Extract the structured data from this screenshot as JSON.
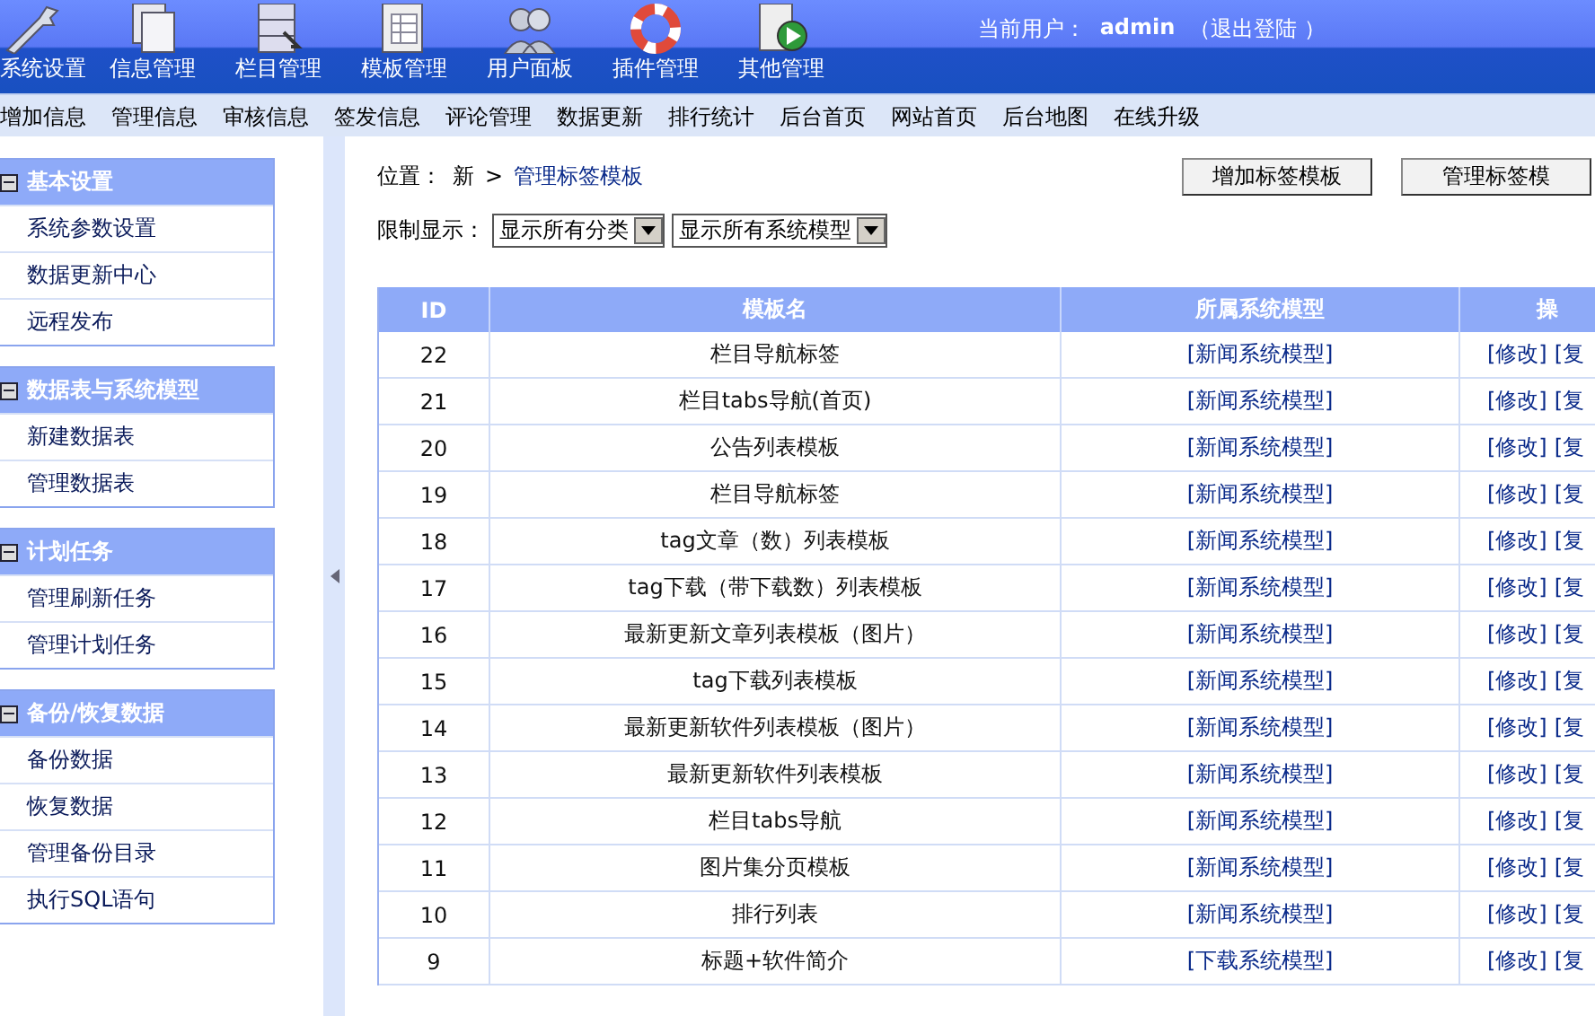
{
  "top_nav": {
    "items": [
      {
        "label": "系统设置",
        "kind": "wrench"
      },
      {
        "label": "信息管理",
        "kind": "pages"
      },
      {
        "label": "栏目管理",
        "kind": "cabinet"
      },
      {
        "label": "模板管理",
        "kind": "document"
      },
      {
        "label": "用户面板",
        "kind": "users"
      },
      {
        "label": "插件管理",
        "kind": "lifebuoy"
      },
      {
        "label": "其他管理",
        "kind": "play"
      }
    ],
    "user_label": "当前用户：",
    "user_name": "admin",
    "logout": "（退出登陆 ）"
  },
  "sub_nav": [
    "增加信息",
    "管理信息",
    "审核信息",
    "签发信息",
    "评论管理",
    "数据更新",
    "排行统计",
    "后台首页",
    "网站首页",
    "后台地图",
    "在线升级"
  ],
  "sidebar": {
    "groups": [
      {
        "title": "基本设置",
        "expanded": true,
        "items": [
          "系统参数设置",
          "数据更新中心",
          "远程发布"
        ]
      },
      {
        "title": "数据表与系统模型",
        "expanded": true,
        "items": [
          "新建数据表",
          "管理数据表"
        ]
      },
      {
        "title": "计划任务",
        "expanded": true,
        "items": [
          "管理刷新任务",
          "管理计划任务"
        ]
      },
      {
        "title": "备份/恢复数据",
        "expanded": true,
        "items": [
          "备份数据",
          "恢复数据",
          "管理备份目录",
          "执行SQL语句"
        ]
      }
    ]
  },
  "breadcrumb": {
    "label": "位置：",
    "items": [
      "新",
      "管理标签模板"
    ],
    "separator": ">"
  },
  "buttons": [
    "增加标签模板",
    "管理标签模"
  ],
  "filter": {
    "label": "限制显示：",
    "selects": [
      "显示所有分类",
      "显示所有系统模型"
    ]
  },
  "table": {
    "columns": [
      "ID",
      "模板名",
      "所属系统模型",
      "操"
    ],
    "rows": [
      {
        "id": "22",
        "name": "栏目导航标签",
        "model": "[新闻系统模型]",
        "actions": [
          "[修改]",
          "[复"
        ]
      },
      {
        "id": "21",
        "name": "栏目tabs导航(首页)",
        "model": "[新闻系统模型]",
        "actions": [
          "[修改]",
          "[复"
        ]
      },
      {
        "id": "20",
        "name": "公告列表模板",
        "model": "[新闻系统模型]",
        "actions": [
          "[修改]",
          "[复"
        ]
      },
      {
        "id": "19",
        "name": "栏目导航标签",
        "model": "[新闻系统模型]",
        "actions": [
          "[修改]",
          "[复"
        ]
      },
      {
        "id": "18",
        "name": "tag文章（数）列表模板",
        "model": "[新闻系统模型]",
        "actions": [
          "[修改]",
          "[复"
        ]
      },
      {
        "id": "17",
        "name": "tag下载（带下载数）列表模板",
        "model": "[新闻系统模型]",
        "actions": [
          "[修改]",
          "[复"
        ]
      },
      {
        "id": "16",
        "name": "最新更新文章列表模板（图片）",
        "model": "[新闻系统模型]",
        "actions": [
          "[修改]",
          "[复"
        ]
      },
      {
        "id": "15",
        "name": "tag下载列表模板",
        "model": "[新闻系统模型]",
        "actions": [
          "[修改]",
          "[复"
        ]
      },
      {
        "id": "14",
        "name": "最新更新软件列表模板（图片）",
        "model": "[新闻系统模型]",
        "actions": [
          "[修改]",
          "[复"
        ]
      },
      {
        "id": "13",
        "name": "最新更新软件列表模板",
        "model": "[新闻系统模型]",
        "actions": [
          "[修改]",
          "[复"
        ]
      },
      {
        "id": "12",
        "name": "栏目tabs导航",
        "model": "[新闻系统模型]",
        "actions": [
          "[修改]",
          "[复"
        ]
      },
      {
        "id": "11",
        "name": "图片集分页模板",
        "model": "[新闻系统模型]",
        "actions": [
          "[修改]",
          "[复"
        ]
      },
      {
        "id": "10",
        "name": "排行列表",
        "model": "[新闻系统模型]",
        "actions": [
          "[修改]",
          "[复"
        ]
      },
      {
        "id": "9",
        "name": "标题+软件简介",
        "model": "[下载系统模型]",
        "actions": [
          "[修改]",
          "[复"
        ]
      }
    ]
  }
}
